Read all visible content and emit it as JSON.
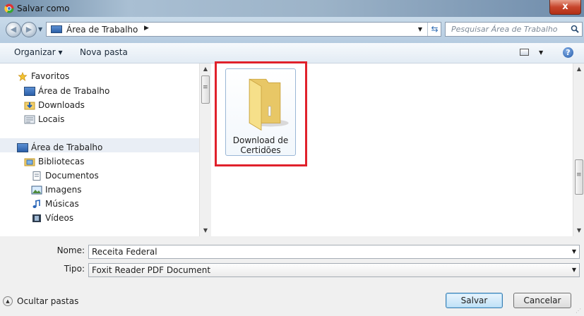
{
  "window": {
    "title": "Salvar como",
    "close_label": "x"
  },
  "address_bar": {
    "location": "Área de Trabalho",
    "search_placeholder": "Pesquisar Área de Trabalho"
  },
  "toolbar": {
    "organize_label": "Organizar ▾",
    "new_folder_label": "Nova pasta",
    "help_label": "?"
  },
  "nav": {
    "favorites": {
      "label": "Favoritos",
      "items": [
        {
          "label": "Área de Trabalho",
          "icon": "desktop-icon"
        },
        {
          "label": "Downloads",
          "icon": "downloads-icon"
        },
        {
          "label": "Locais",
          "icon": "recent-places-icon"
        }
      ]
    },
    "desktop": {
      "label": "Área de Trabalho",
      "children": [
        {
          "label": "Bibliotecas",
          "icon": "libraries-icon"
        }
      ],
      "library_items": [
        {
          "label": "Documentos",
          "icon": "documents-icon"
        },
        {
          "label": "Imagens",
          "icon": "pictures-icon"
        },
        {
          "label": "Músicas",
          "icon": "music-icon"
        },
        {
          "label": "Vídeos",
          "icon": "videos-icon"
        }
      ]
    }
  },
  "content": {
    "items": [
      {
        "line1": "Download de",
        "line2": "Certidões",
        "type": "folder",
        "selected": true
      }
    ]
  },
  "form": {
    "name_label": "Nome:",
    "name_value": "Receita Federal",
    "type_label": "Tipo:",
    "type_value": "Foxit Reader PDF Document"
  },
  "footer": {
    "hide_folders_label": "Ocultar pastas",
    "save_label": "Salvar",
    "cancel_label": "Cancelar"
  },
  "colors": {
    "highlight": "#e0212b",
    "title_bar": "#9cb3c8",
    "close_button": "#c7452c"
  }
}
